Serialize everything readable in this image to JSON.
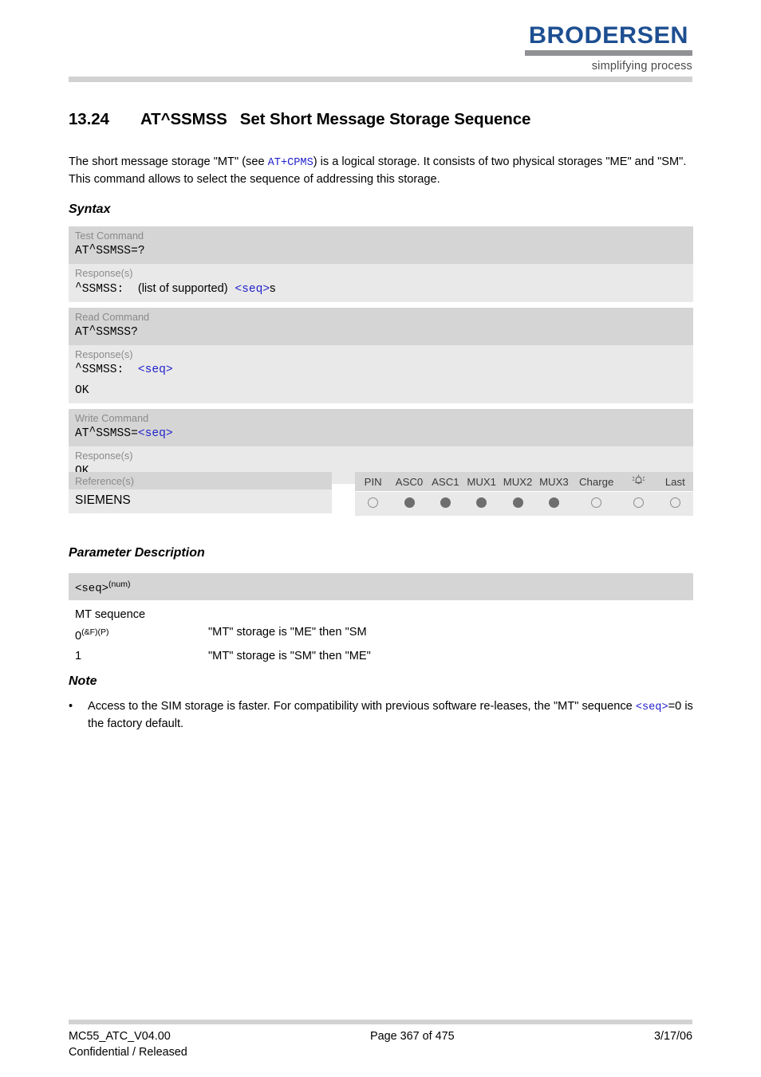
{
  "header": {
    "logo_word": "BRODERSEN",
    "logo_tagline": "simplifying process",
    "logo_color": "#1d4f91",
    "logo_bar_color": "#8f9194"
  },
  "title": {
    "number": "13.24",
    "command": "AT^SSMSS",
    "name": "Set Short Message Storage Sequence"
  },
  "intro": {
    "part1": "The short message storage \"MT\" (see ",
    "link": "AT+CPMS",
    "part2": ") is a logical storage. It consists of two physical storages \"ME\" and \"SM\". This command allows to select the sequence of addressing this storage."
  },
  "sections": {
    "syntax": "Syntax",
    "parameter_description": "Parameter Description",
    "note": "Note"
  },
  "syntax": {
    "blocks": [
      {
        "cmd_label": "Test Command",
        "cmd_prefix": "AT",
        "cmd_caret": "^",
        "cmd_suffix": "SSMSS=?",
        "resp_label": "Response(s)",
        "resp_caret": "^",
        "resp_name": "SSMSS:",
        "resp_text": "(list of supported)",
        "resp_param": "<seq>",
        "resp_tail": "s",
        "resp_ok": ""
      },
      {
        "cmd_label": "Read Command",
        "cmd_prefix": "AT",
        "cmd_caret": "^",
        "cmd_suffix": "SSMSS?",
        "resp_label": "Response(s)",
        "resp_caret": "^",
        "resp_name": "SSMSS:",
        "resp_text": "",
        "resp_param": "<seq>",
        "resp_tail": "",
        "resp_ok": "OK"
      },
      {
        "cmd_label": "Write Command",
        "cmd_prefix": "AT",
        "cmd_caret": "^",
        "cmd_suffix": "SSMSS=",
        "cmd_param": "<seq>",
        "resp_label": "Response(s)",
        "resp_ok": "OK"
      }
    ],
    "reference": {
      "label": "Reference(s)",
      "value": "SIEMENS"
    },
    "capabilities": {
      "columns": [
        "PIN",
        "ASC0",
        "ASC1",
        "MUX1",
        "MUX2",
        "MUX3",
        "Charge",
        "alarm-icon",
        "Last"
      ],
      "values": [
        false,
        true,
        true,
        true,
        true,
        true,
        false,
        false,
        false
      ]
    }
  },
  "parameter": {
    "key": "<seq>",
    "key_sup": "(num)",
    "description": "MT sequence",
    "values": [
      {
        "value": "0",
        "sup": "(&F)(P)",
        "desc": "\"MT\" storage is \"ME\" then \"SM"
      },
      {
        "value": "1",
        "sup": "",
        "desc": "\"MT\" storage is \"SM\" then \"ME\""
      }
    ]
  },
  "note": {
    "bullet": "•",
    "text_part1": "Access to the SIM storage is faster. For compatibility with previous software re-leases, the \"MT\" sequence ",
    "text_param": "<seq>",
    "text_part2": "=0 is the factory default."
  },
  "footer": {
    "document": "MC55_ATC_V04.00",
    "classification": "Confidential / Released",
    "page": "Page 367 of 475",
    "date": "3/17/06"
  }
}
